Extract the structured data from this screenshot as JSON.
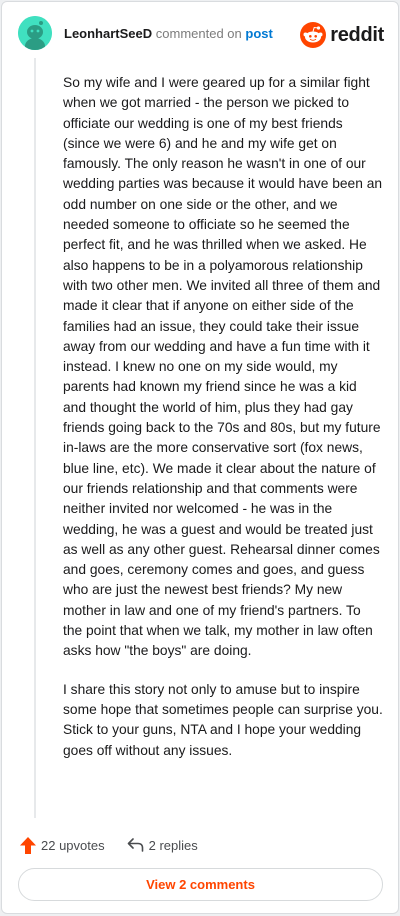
{
  "header": {
    "username": "LeonhartSeeD",
    "action_text": "commented on",
    "target_text": "post",
    "brand_name": "reddit"
  },
  "comment": {
    "paragraphs": [
      "So my wife and I were geared up for a similar fight when we got married - the person we picked to officiate our wedding is one of my best friends (since we were 6) and he and my wife get on famously. The only reason he wasn't in one of our wedding parties was because it would have been an odd number on one side or the other, and we needed someone to officiate so he seemed the perfect fit, and he was thrilled when we asked. He also happens to be in a polyamorous relationship with two other men. We invited all three of them and made it clear that if anyone on either side of the families had an issue, they could take their issue away from our wedding and have a fun time with it instead. I knew no one on my side would, my parents had known my friend since he was a kid and thought the world of him, plus they had gay friends going back to the 70s and 80s, but my future in-laws are the more conservative sort (fox news, blue line, etc). We made it clear about the nature of our friends relationship and that comments were neither invited nor welcomed - he was in the wedding, he was a guest and would be treated just as well as any other guest. Rehearsal dinner comes and goes, ceremony comes and goes, and guess who are just the newest best friends? My new mother in law and one of my friend's partners. To the point that when we talk, my mother in law often asks how \"the boys\" are doing.",
      "I share this story not only to amuse but to inspire some hope that sometimes people can surprise you. Stick to your guns, NTA and I hope your wedding goes off without any issues."
    ]
  },
  "footer": {
    "upvotes_label": "22 upvotes",
    "replies_label": "2 replies",
    "view_comments_label": "View 2 comments"
  },
  "icons": {
    "avatar": "snoo-avatar-icon",
    "brand": "reddit-logo-icon",
    "upvote": "upvote-arrow-icon",
    "reply": "reply-arrow-icon"
  },
  "colors": {
    "accent": "#ff4500",
    "link": "#0079d3",
    "avatar_bg": "#40e0c0",
    "text": "#1a1a1b",
    "muted": "#7c7c7c"
  }
}
